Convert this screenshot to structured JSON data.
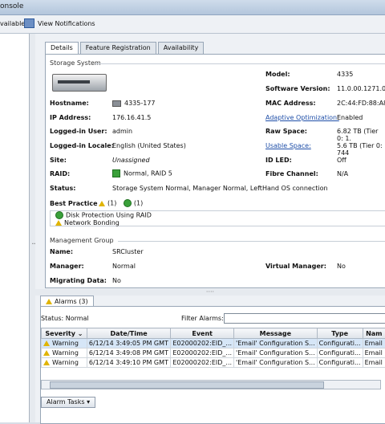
{
  "window": {
    "title": "onsole"
  },
  "toolbar": {
    "available": "vailable",
    "view_notifications": "View Notifications"
  },
  "tabs": [
    "Details",
    "Feature Registration",
    "Availability"
  ],
  "storage_system": {
    "group_title": "Storage System",
    "hostname_label": "Hostname:",
    "hostname": "4335-177",
    "ip_label": "IP Address:",
    "ip": "176.16.41.5",
    "logged_user_label": "Logged-in User:",
    "logged_user": "admin",
    "locale_label": "Logged-in Locale:",
    "locale": "English (United States)",
    "site_label": "Site:",
    "site": "Unassigned",
    "raid_label": "RAID:",
    "raid": "Normal, RAID 5",
    "status_label": "Status:",
    "status": "Storage System Normal, Manager Normal, LeftHand OS connection",
    "model_label": "Model:",
    "model": "4335",
    "sw_label": "Software Version:",
    "sw": "11.0.00.1271.0",
    "mac_label": "MAC Address:",
    "mac": "2C:44:FD:88:A8:B",
    "ao_label": "Adaptive Optimization:",
    "ao": "Enabled",
    "raw_label": "Raw Space:",
    "raw": "6.82 TB (Tier 0: 1.",
    "usable_label": "Usable Space:",
    "usable": "5.6 TB (Tier 0: 744",
    "idled_label": "ID LED:",
    "idled": "Off",
    "fc_label": "Fibre Channel:",
    "fc": "N/A"
  },
  "best_practice": {
    "label": "Best Practice",
    "warn_count": "(1)",
    "ok_count": "(1)",
    "items": [
      "Disk Protection Using RAID",
      "Network Bonding"
    ]
  },
  "management_group": {
    "group_title": "Management Group",
    "name_label": "Name:",
    "name": "SRCluster",
    "manager_label": "Manager:",
    "manager": "Normal",
    "migrating_label": "Migrating Data:",
    "migrating": "No",
    "vm_label": "Virtual Manager:",
    "vm": "No"
  },
  "alarms": {
    "tab_label": "Alarms (3)",
    "status_label": "Status:",
    "status": "Normal",
    "filter_label": "Filter Alarms:",
    "columns": [
      "Severity",
      "Date/Time",
      "Event",
      "Message",
      "Type",
      "Nam"
    ],
    "rows": [
      {
        "severity": "Warning",
        "datetime": "6/12/14 3:49:05 PM GMT",
        "event": "E02000202:EID_...",
        "message": "'Email' Configuration S...",
        "type": "Configurati...",
        "name": "Email"
      },
      {
        "severity": "Warning",
        "datetime": "6/12/14 3:49:08 PM GMT",
        "event": "E02000202:EID_...",
        "message": "'Email' Configuration S...",
        "type": "Configurati...",
        "name": "Email"
      },
      {
        "severity": "Warning",
        "datetime": "6/12/14 3:49:10 PM GMT",
        "event": "E02000202:EID_...",
        "message": "'Email' Configuration S...",
        "type": "Configurati...",
        "name": "Email"
      }
    ],
    "tasks_button": "Alarm Tasks"
  }
}
